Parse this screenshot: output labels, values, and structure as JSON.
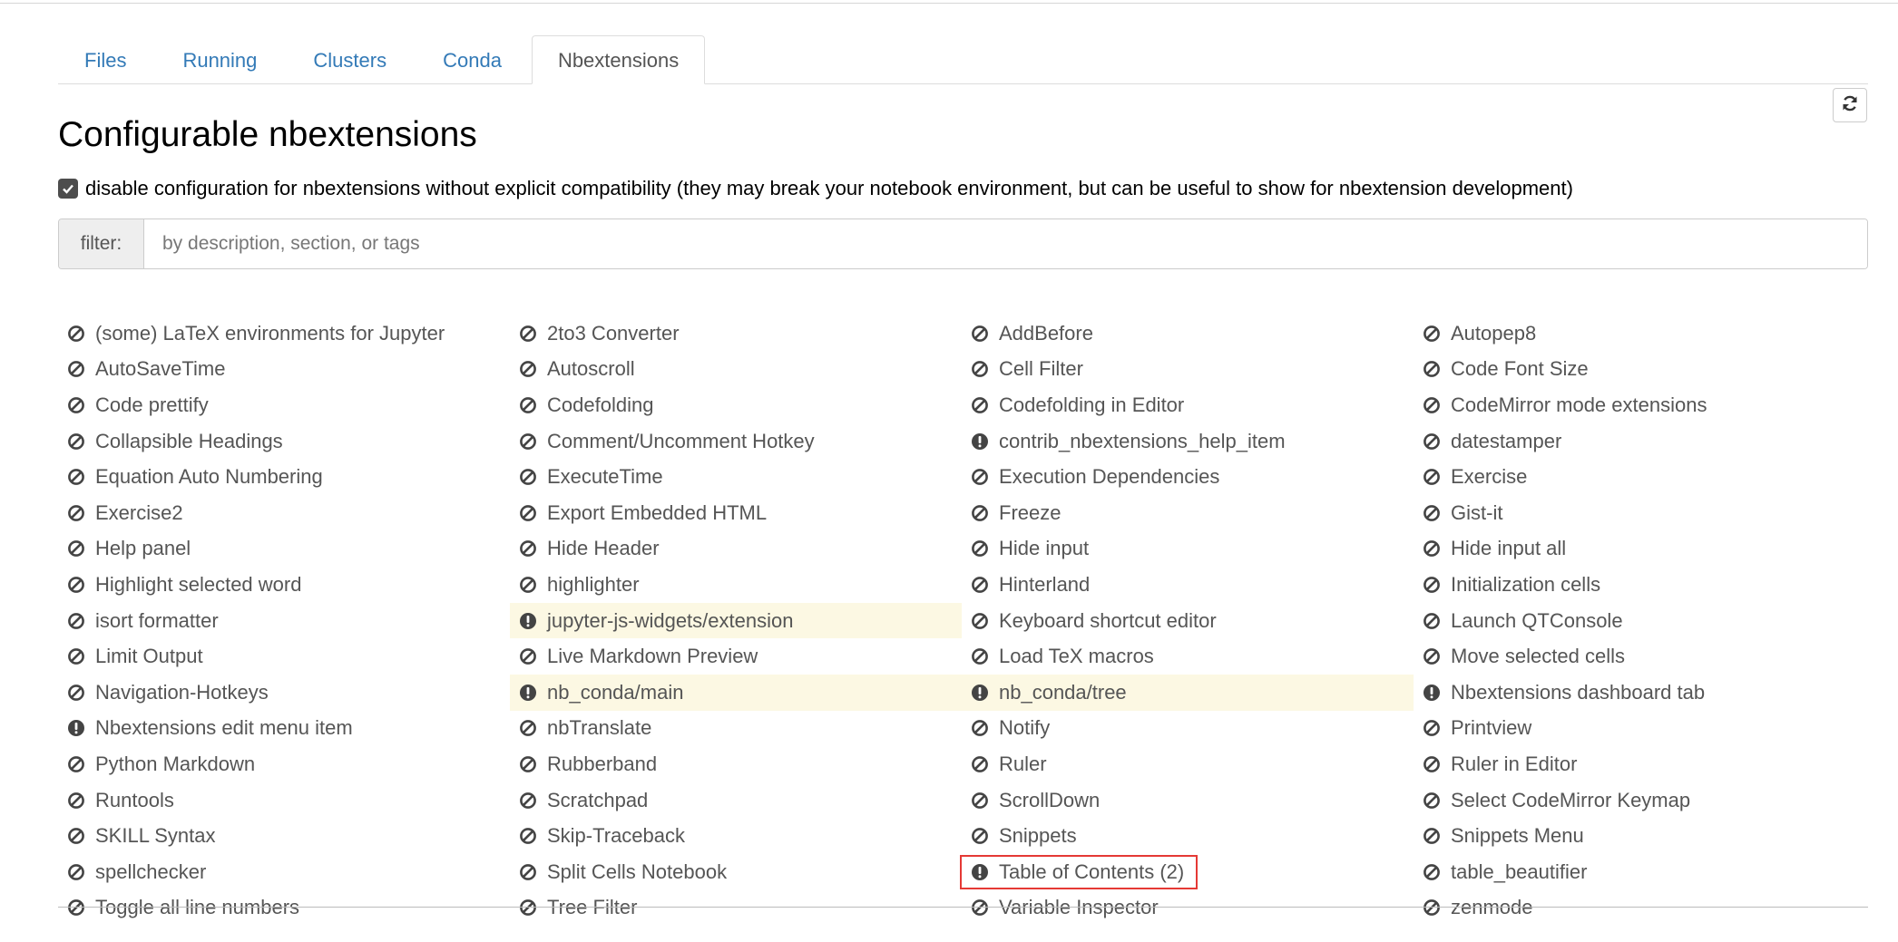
{
  "tabs": [
    {
      "label": "Files"
    },
    {
      "label": "Running"
    },
    {
      "label": "Clusters"
    },
    {
      "label": "Conda"
    },
    {
      "label": "Nbextensions"
    }
  ],
  "active_tab": "Nbextensions",
  "page_title": "Configurable nbextensions",
  "compat": {
    "checked": true,
    "label": "disable configuration for nbextensions without explicit compatibility (they may break your notebook environment, but can be useful to show for nbextension development)"
  },
  "filter": {
    "label": "filter:",
    "placeholder": "by description, section, or tags",
    "value": ""
  },
  "colors": {
    "link": "#337ab7",
    "item_text": "#555555",
    "warn_bg": "#fcf8e3",
    "selected_outline": "#e53935"
  },
  "extensions": [
    {
      "label": "(some) LaTeX environments for Jupyter",
      "icon": "disabled-icon",
      "warn": false
    },
    {
      "label": "2to3 Converter",
      "icon": "disabled-icon",
      "warn": false
    },
    {
      "label": "AddBefore",
      "icon": "disabled-icon",
      "warn": false
    },
    {
      "label": "Autopep8",
      "icon": "disabled-icon",
      "warn": false
    },
    {
      "label": "AutoSaveTime",
      "icon": "disabled-icon",
      "warn": false
    },
    {
      "label": "Autoscroll",
      "icon": "disabled-icon",
      "warn": false
    },
    {
      "label": "Cell Filter",
      "icon": "disabled-icon",
      "warn": false
    },
    {
      "label": "Code Font Size",
      "icon": "disabled-icon",
      "warn": false
    },
    {
      "label": "Code prettify",
      "icon": "disabled-icon",
      "warn": false
    },
    {
      "label": "Codefolding",
      "icon": "disabled-icon",
      "warn": false
    },
    {
      "label": "Codefolding in Editor",
      "icon": "disabled-icon",
      "warn": false
    },
    {
      "label": "CodeMirror mode extensions",
      "icon": "disabled-icon",
      "warn": false
    },
    {
      "label": "Collapsible Headings",
      "icon": "disabled-icon",
      "warn": false
    },
    {
      "label": "Comment/Uncomment Hotkey",
      "icon": "disabled-icon",
      "warn": false
    },
    {
      "label": "contrib_nbextensions_help_item",
      "icon": "exclamation-icon",
      "warn": false
    },
    {
      "label": "datestamper",
      "icon": "disabled-icon",
      "warn": false
    },
    {
      "label": "Equation Auto Numbering",
      "icon": "disabled-icon",
      "warn": false
    },
    {
      "label": "ExecuteTime",
      "icon": "disabled-icon",
      "warn": false
    },
    {
      "label": "Execution Dependencies",
      "icon": "disabled-icon",
      "warn": false
    },
    {
      "label": "Exercise",
      "icon": "disabled-icon",
      "warn": false
    },
    {
      "label": "Exercise2",
      "icon": "disabled-icon",
      "warn": false
    },
    {
      "label": "Export Embedded HTML",
      "icon": "disabled-icon",
      "warn": false
    },
    {
      "label": "Freeze",
      "icon": "disabled-icon",
      "warn": false
    },
    {
      "label": "Gist-it",
      "icon": "disabled-icon",
      "warn": false
    },
    {
      "label": "Help panel",
      "icon": "disabled-icon",
      "warn": false
    },
    {
      "label": "Hide Header",
      "icon": "disabled-icon",
      "warn": false
    },
    {
      "label": "Hide input",
      "icon": "disabled-icon",
      "warn": false
    },
    {
      "label": "Hide input all",
      "icon": "disabled-icon",
      "warn": false
    },
    {
      "label": "Highlight selected word",
      "icon": "disabled-icon",
      "warn": false
    },
    {
      "label": "highlighter",
      "icon": "disabled-icon",
      "warn": false
    },
    {
      "label": "Hinterland",
      "icon": "disabled-icon",
      "warn": false
    },
    {
      "label": "Initialization cells",
      "icon": "disabled-icon",
      "warn": false
    },
    {
      "label": "isort formatter",
      "icon": "disabled-icon",
      "warn": false
    },
    {
      "label": "jupyter-js-widgets/extension",
      "icon": "exclamation-icon",
      "warn": true
    },
    {
      "label": "Keyboard shortcut editor",
      "icon": "disabled-icon",
      "warn": false
    },
    {
      "label": "Launch QTConsole",
      "icon": "disabled-icon",
      "warn": false
    },
    {
      "label": "Limit Output",
      "icon": "disabled-icon",
      "warn": false
    },
    {
      "label": "Live Markdown Preview",
      "icon": "disabled-icon",
      "warn": false
    },
    {
      "label": "Load TeX macros",
      "icon": "disabled-icon",
      "warn": false
    },
    {
      "label": "Move selected cells",
      "icon": "disabled-icon",
      "warn": false
    },
    {
      "label": "Navigation-Hotkeys",
      "icon": "disabled-icon",
      "warn": false
    },
    {
      "label": "nb_conda/main",
      "icon": "exclamation-icon",
      "warn": true
    },
    {
      "label": "nb_conda/tree",
      "icon": "exclamation-icon",
      "warn": true
    },
    {
      "label": "Nbextensions dashboard tab",
      "icon": "exclamation-icon",
      "warn": false
    },
    {
      "label": "Nbextensions edit menu item",
      "icon": "exclamation-icon",
      "warn": false
    },
    {
      "label": "nbTranslate",
      "icon": "disabled-icon",
      "warn": false
    },
    {
      "label": "Notify",
      "icon": "disabled-icon",
      "warn": false
    },
    {
      "label": "Printview",
      "icon": "disabled-icon",
      "warn": false
    },
    {
      "label": "Python Markdown",
      "icon": "disabled-icon",
      "warn": false
    },
    {
      "label": "Rubberband",
      "icon": "disabled-icon",
      "warn": false
    },
    {
      "label": "Ruler",
      "icon": "disabled-icon",
      "warn": false
    },
    {
      "label": "Ruler in Editor",
      "icon": "disabled-icon",
      "warn": false
    },
    {
      "label": "Runtools",
      "icon": "disabled-icon",
      "warn": false
    },
    {
      "label": "Scratchpad",
      "icon": "disabled-icon",
      "warn": false
    },
    {
      "label": "ScrollDown",
      "icon": "disabled-icon",
      "warn": false
    },
    {
      "label": "Select CodeMirror Keymap",
      "icon": "disabled-icon",
      "warn": false
    },
    {
      "label": "SKILL Syntax",
      "icon": "disabled-icon",
      "warn": false
    },
    {
      "label": "Skip-Traceback",
      "icon": "disabled-icon",
      "warn": false
    },
    {
      "label": "Snippets",
      "icon": "disabled-icon",
      "warn": false
    },
    {
      "label": "Snippets Menu",
      "icon": "disabled-icon",
      "warn": false
    },
    {
      "label": "spellchecker",
      "icon": "disabled-icon",
      "warn": false
    },
    {
      "label": "Split Cells Notebook",
      "icon": "disabled-icon",
      "warn": false
    },
    {
      "label": "Table of Contents (2)",
      "icon": "exclamation-icon",
      "warn": false,
      "selected": true
    },
    {
      "label": "table_beautifier",
      "icon": "disabled-icon",
      "warn": false
    },
    {
      "label": "Toggle all line numbers",
      "icon": "disabled-icon",
      "warn": false
    },
    {
      "label": "Tree Filter",
      "icon": "disabled-icon",
      "warn": false
    },
    {
      "label": "Variable Inspector",
      "icon": "disabled-icon",
      "warn": false
    },
    {
      "label": "zenmode",
      "icon": "disabled-icon",
      "warn": false
    }
  ]
}
